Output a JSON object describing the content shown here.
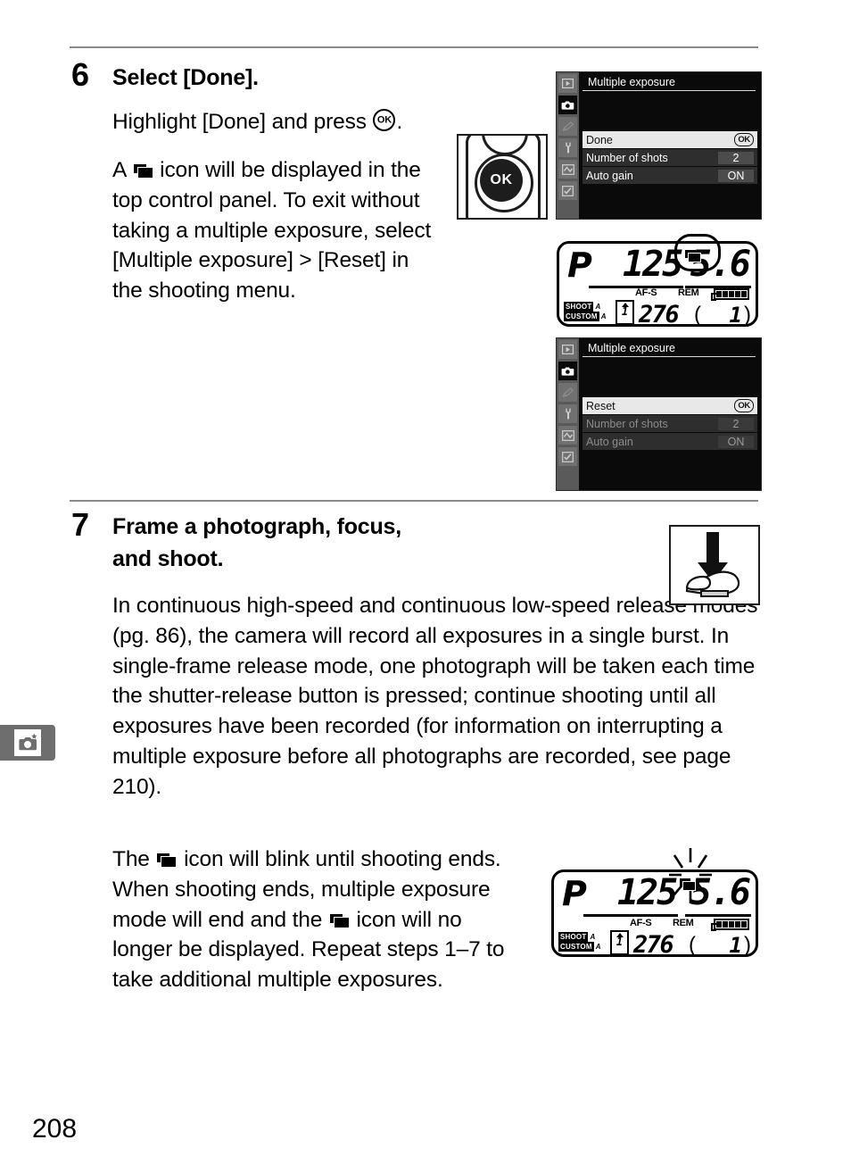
{
  "page": {
    "number": "208",
    "sidebar_tab_icon": "camera-star-icon"
  },
  "steps": [
    {
      "number": "6",
      "title_bold": "Select",
      "title_rest": " [Done].",
      "paragraph_1_before": "Highlight [Done] and press ",
      "paragraph_1_after": ".",
      "paragraph_2_before": "A ",
      "paragraph_2_after": " icon will be displayed in the top control panel.  To exit without taking a multiple exposure, select [Multiple exposure] > [Reset] in the shooting menu."
    },
    {
      "number": "7",
      "title": "Frame a photograph, focus, and shoot.",
      "paragraph_1": "In continuous high-speed and continuous low-speed release modes (pg. 86), the camera will record all exposures in a single burst.  In single-frame release mode, one photograph will be taken each time the shutter-release button is pressed; continue shooting until all exposures have been recorded (for information on interrupting a multiple exposure before all photographs are recorded, see page 210).",
      "paragraph_2_a": "The ",
      "paragraph_2_b": " icon will blink until shooting ends.  When shooting ends, multiple exposure mode will end and the ",
      "paragraph_2_c": " icon will no longer be displayed.  Repeat steps 1–7 to take additional multiple exposures."
    }
  ],
  "ok_button_figure": {
    "label": "OK"
  },
  "shutter_figure": {
    "name": "press-shutter-button-illustration"
  },
  "menu_screenshots": [
    {
      "header": "Multiple exposure",
      "rail_icons": [
        "playback-icon",
        "shooting-menu-icon",
        "custom-settings-icon",
        "setup-menu-icon",
        "retouch-menu-icon",
        "recent-settings-icon"
      ],
      "rail_active_index": 1,
      "rows": [
        {
          "label": "Done",
          "value": "OK",
          "value_is_badge": true,
          "selected": true,
          "dimmed": false
        },
        {
          "label": "Number of shots",
          "value": "2",
          "value_is_badge": false,
          "selected": false,
          "dimmed": false
        },
        {
          "label": "Auto gain",
          "value": "ON",
          "value_is_badge": false,
          "selected": false,
          "dimmed": false
        }
      ]
    },
    {
      "header": "Multiple exposure",
      "rail_icons": [
        "playback-icon",
        "shooting-menu-icon",
        "custom-settings-icon",
        "setup-menu-icon",
        "retouch-menu-icon",
        "recent-settings-icon"
      ],
      "rail_active_index": 1,
      "rows": [
        {
          "label": "Reset",
          "value": "OK",
          "value_is_badge": true,
          "selected": true,
          "dimmed": false
        },
        {
          "label": "Number of shots",
          "value": "2",
          "value_is_badge": false,
          "selected": false,
          "dimmed": true
        },
        {
          "label": "Auto gain",
          "value": "ON",
          "value_is_badge": false,
          "selected": false,
          "dimmed": true
        }
      ]
    }
  ],
  "lcd_panels": [
    {
      "id": "lcd-top",
      "mode": "P",
      "shutter_speed": "125",
      "aperture": "5.6",
      "af_mode": "AF-S",
      "rem_label": "REM",
      "shoot_tag": "SHOOT",
      "shoot_bank": "A",
      "custom_tag": "CUSTOM",
      "custom_bank": "A",
      "release_bank": "1",
      "frames_remaining": "276",
      "buffer_open": "(",
      "buffer_count": "1",
      "buffer_close": ")",
      "me_icon_highlighted": true,
      "me_icon_blinking": false
    },
    {
      "id": "lcd-bottom",
      "mode": "P",
      "shutter_speed": "125",
      "aperture": "5.6",
      "af_mode": "AF-S",
      "rem_label": "REM",
      "shoot_tag": "SHOOT",
      "shoot_bank": "A",
      "custom_tag": "CUSTOM",
      "custom_bank": "A",
      "release_bank": "1",
      "frames_remaining": "276",
      "buffer_open": "(",
      "buffer_count": "1",
      "buffer_close": ")",
      "me_icon_highlighted": false,
      "me_icon_blinking": true
    }
  ],
  "colors": {
    "rule": "#8a8a8a",
    "side_tab": "#6e6e6e",
    "menu_rail": "#5a5a5a",
    "menu_background": "#0a0a0a",
    "menu_row": "#2e2e2e",
    "menu_selected": "#e8e8e8"
  }
}
